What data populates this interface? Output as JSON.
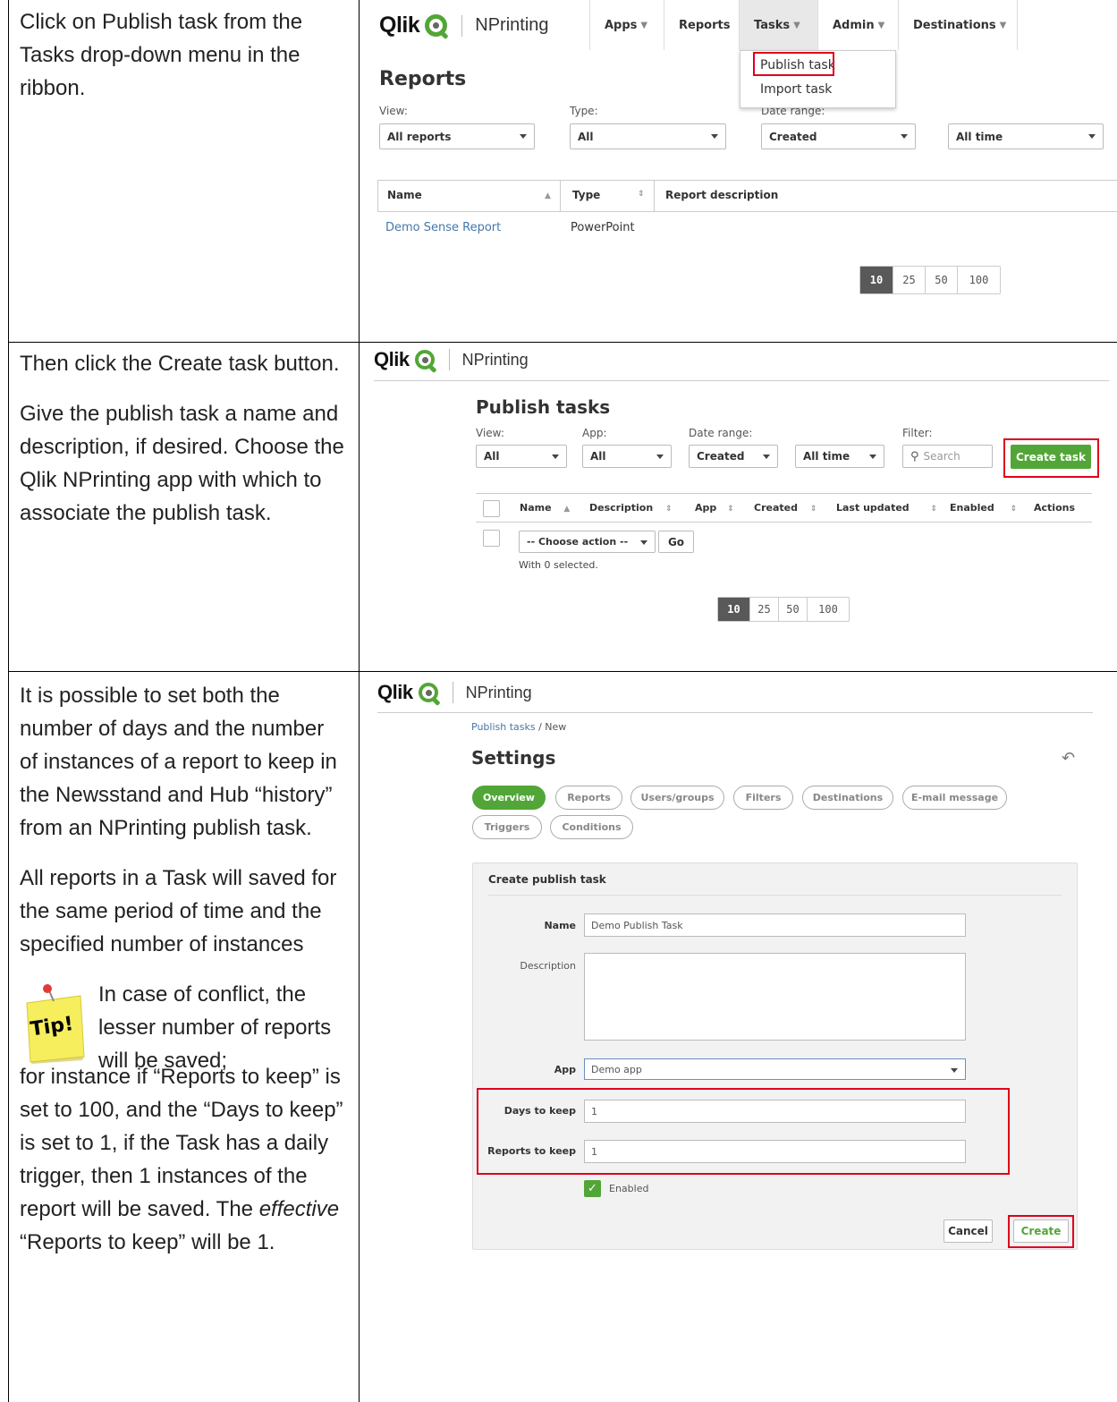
{
  "row1": {
    "instruction": "Click on Publish task from the Tasks drop-down menu in the ribbon.",
    "brand": "Qlik",
    "product": "NPrinting",
    "nav": [
      "Apps",
      "Reports",
      "Tasks",
      "Admin",
      "Destinations"
    ],
    "menu": [
      "Publish task",
      "Import task"
    ],
    "title": "Reports",
    "filters": {
      "view_label": "View:",
      "view": "All reports",
      "type_label": "Type:",
      "type": "All",
      "date_label": "Date range:",
      "date": "Created",
      "range": "All time"
    },
    "columns": [
      "Name",
      "Type",
      "Report description"
    ],
    "rows": [
      {
        "name": "Demo Sense Report",
        "type": "PowerPoint",
        "description": ""
      }
    ],
    "pager": [
      "10",
      "25",
      "50",
      "100"
    ]
  },
  "row2": {
    "instructions": [
      "Then click the Create task button.",
      "Give the publish task a name and description, if desired. Choose the Qlik NPrinting app with which to associate the publish task."
    ],
    "title": "Publish tasks",
    "labels": {
      "view": "View:",
      "app": "App:",
      "date": "Date range:",
      "filter": "Filter:"
    },
    "view": "All",
    "app": "All",
    "date": "Created",
    "range": "All time",
    "search_placeholder": "Search",
    "create_task": "Create task",
    "columns": [
      "Name",
      "Description",
      "App",
      "Created",
      "Last updated",
      "Enabled",
      "Actions"
    ],
    "choose_action": "-- Choose action --",
    "go": "Go",
    "selected_text": "With 0 selected.",
    "pager": [
      "10",
      "25",
      "50",
      "100"
    ]
  },
  "row3": {
    "instructions": [
      "It is possible to set both the number of days and the number of instances of a report to keep in the Newsstand and Hub “history” from an NPrinting publish task.",
      "All reports in a Task will saved for the same period of time and the specified number of instances"
    ],
    "tip_label": "Tip!",
    "tip_text_start": "In case of conflict, the lesser number of reports will be saved;",
    "tip_text_rest_before": "for instance if “Reports to keep” is set to 100, and the “Days to keep” is set to 1, if the Task has a daily trigger, then 1 instances of the report will be saved. The ",
    "tip_text_emph": "effective",
    "tip_text_rest_after": " “Reports to keep” will be 1.",
    "breadcrumb_link": "Publish tasks",
    "breadcrumb_current": " / New",
    "title": "Settings",
    "tabs": [
      "Overview",
      "Reports",
      "Users/groups",
      "Filters",
      "Destinations",
      "E-mail message",
      "Triggers",
      "Conditions"
    ],
    "panel_title": "Create publish task",
    "name_label": "Name",
    "name_value": "Demo Publish Task",
    "description_label": "Description",
    "app_label": "App",
    "app_value": "Demo app",
    "days_label": "Days to keep",
    "days_value": "1",
    "reports_label": "Reports to keep",
    "reports_value": "1",
    "enabled_label": "Enabled",
    "cancel": "Cancel",
    "create": "Create"
  }
}
